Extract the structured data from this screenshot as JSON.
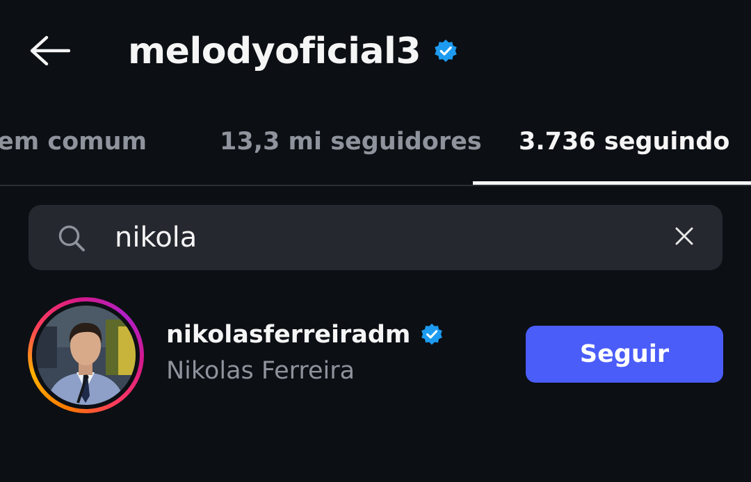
{
  "header": {
    "title": "melodyoficial3",
    "back_icon": "arrow-left-icon",
    "verified_icon": "verified-badge-icon"
  },
  "tabs": [
    {
      "label": "em comum",
      "active": false
    },
    {
      "label": "13,3 mi seguidores",
      "active": false
    },
    {
      "label": "3.736 seguindo",
      "active": true
    }
  ],
  "search": {
    "value": "nikola",
    "icon": "search-icon",
    "clear_icon": "close-icon"
  },
  "results": [
    {
      "username": "nikolasferreiradm",
      "full_name": "Nikolas Ferreira",
      "verified": true,
      "has_story": true,
      "action_label": "Seguir"
    }
  ],
  "colors": {
    "background": "#0c0f14",
    "search_bg": "#25282f",
    "follow_button": "#4a5df9",
    "verified_badge": "#1d9bf0",
    "muted_text": "#8e939c"
  }
}
